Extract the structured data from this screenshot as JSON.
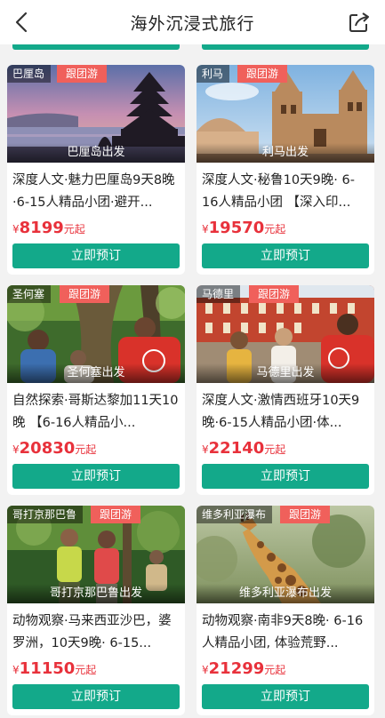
{
  "header": {
    "title": "海外沉浸式旅行"
  },
  "colors": {
    "accent": "#13a98a",
    "price": "#e8313b",
    "tag": "#f0605b"
  },
  "icons": {
    "back": "chevron-left-icon",
    "share": "share-icon"
  },
  "cards": [
    {
      "location_tag": "巴厘岛",
      "type_tag": "跟团游",
      "departure": "巴厘岛出发",
      "description": "深度人文·魅力巴厘岛9天8晚·6-15人精品小团·避开...",
      "currency": "¥",
      "price": "8199",
      "price_suffix": "元起",
      "button": "立即预订"
    },
    {
      "location_tag": "利马",
      "type_tag": "跟团游",
      "departure": "利马出发",
      "description": "深度人文·秘鲁10天9晚· 6-16人精品小团 【深入印...",
      "currency": "¥",
      "price": "19570",
      "price_suffix": "元起",
      "button": "立即预订"
    },
    {
      "location_tag": "圣何塞",
      "type_tag": "跟团游",
      "departure": "圣何塞出发",
      "description": "自然探索·哥斯达黎加11天10晚 【6-16人精品小...",
      "currency": "¥",
      "price": "20830",
      "price_suffix": "元起",
      "button": "立即预订"
    },
    {
      "location_tag": "马德里",
      "type_tag": "跟团游",
      "departure": "马德里出发",
      "description": "深度人文·激情西班牙10天9晚·6-15人精品小团·体...",
      "currency": "¥",
      "price": "22140",
      "price_suffix": "元起",
      "button": "立即预订"
    },
    {
      "location_tag": "哥打京那巴鲁",
      "type_tag": "跟团游",
      "departure": "哥打京那巴鲁出发",
      "description": "动物观察·马来西亚沙巴，婆罗洲，10天9晚· 6-15...",
      "currency": "¥",
      "price": "11150",
      "price_suffix": "元起",
      "button": "立即预订"
    },
    {
      "location_tag": "维多利亚瀑布",
      "type_tag": "跟团游",
      "departure": "维多利亚瀑布出发",
      "description": "动物观察·南非9天8晚· 6-16人精品小团, 体验荒野...",
      "currency": "¥",
      "price": "21299",
      "price_suffix": "元起",
      "button": "立即预订"
    }
  ]
}
